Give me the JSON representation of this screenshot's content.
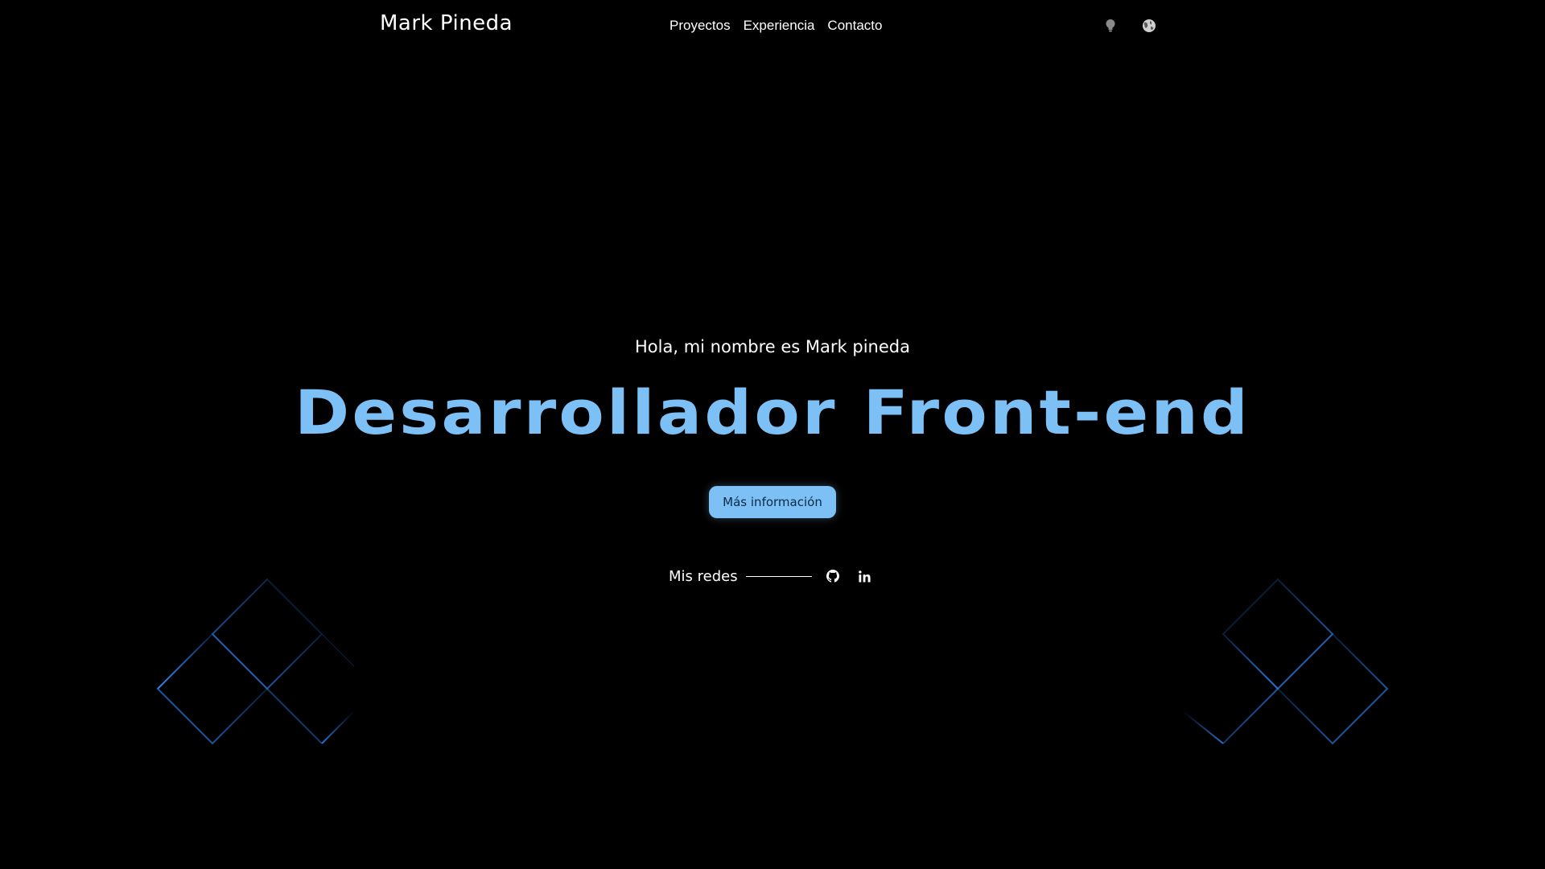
{
  "header": {
    "brand": "Mark Pineda",
    "nav": [
      "Proyectos",
      "Experiencia",
      "Contacto"
    ],
    "icons": [
      "lightbulb-icon",
      "globe-icon"
    ]
  },
  "hero": {
    "greeting": "Hola, mi nombre es Mark pineda",
    "title": "Desarrollador Front-end",
    "cta_label": "Más información",
    "socials_label": "Mis redes",
    "social_icons": [
      "github-icon",
      "linkedin-icon"
    ]
  },
  "colors": {
    "background": "#000000",
    "accent": "#7cc0f5",
    "text": "#ffffff"
  }
}
